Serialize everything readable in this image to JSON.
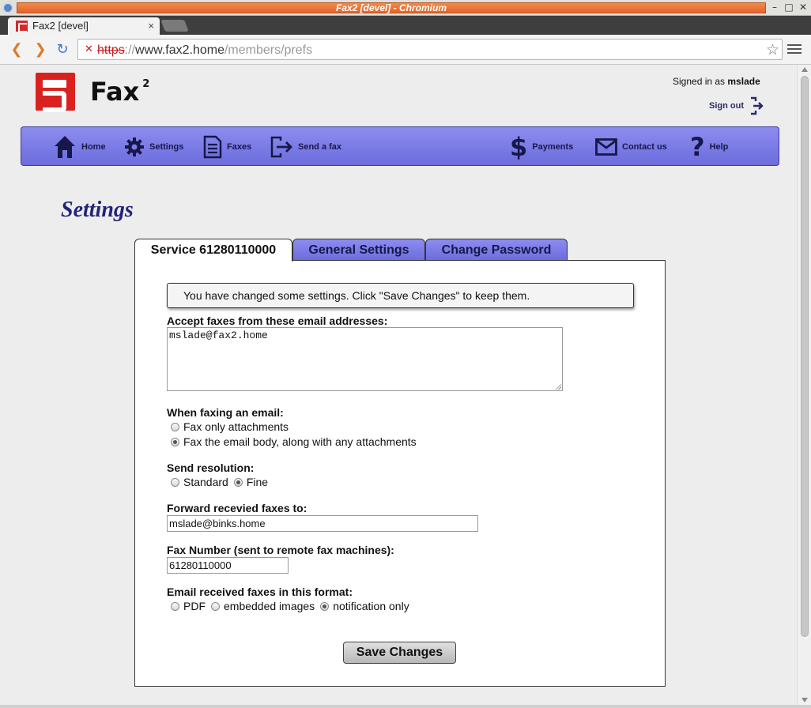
{
  "window": {
    "title": "Fax2 [devel] - Chromium"
  },
  "browser": {
    "tab_title": "Fax2 [devel]",
    "tab_close": "×",
    "url_scheme": "https",
    "url_sep": "://",
    "url_host": "www.fax2.home",
    "url_path": "/members/prefs"
  },
  "header": {
    "brand": "Fax",
    "brand_sup": "2",
    "signed_in_prefix": "Signed in as ",
    "username": "mslade",
    "signout_label": "Sign out"
  },
  "nav": {
    "home": "Home",
    "settings": "Settings",
    "faxes": "Faxes",
    "send": "Send a fax",
    "payments": "Payments",
    "contact": "Contact us",
    "help": "Help"
  },
  "page": {
    "title": "Settings"
  },
  "tabs": {
    "service": "Service 61280110000",
    "general": "General Settings",
    "password": "Change Password"
  },
  "form": {
    "notice": "You have changed some settings. Click \"Save Changes\" to keep them.",
    "accept_label": "Accept faxes from these email addresses:",
    "accept_value": "mslade@fax2.home",
    "when_label": "When faxing an email:",
    "when_opt1": "Fax only attachments",
    "when_opt2": "Fax the email body, along with any attachments",
    "res_label": "Send resolution:",
    "res_opt1": "Standard",
    "res_opt2": "Fine",
    "forward_label": "Forward recevied faxes to:",
    "forward_value": "mslade@binks.home",
    "faxnum_label": "Fax Number (sent to remote fax machines):",
    "faxnum_value": "61280110000",
    "format_label": "Email received faxes in this format:",
    "format_opt1": "PDF",
    "format_opt2": "embedded images",
    "format_opt3": "notification only",
    "save_label": "Save Changes"
  },
  "colors": {
    "nav_gradient_top": "#8c8cf0",
    "nav_gradient_bottom": "#6c6cdc",
    "heading": "#23237a",
    "logo_red": "#d9221f"
  }
}
